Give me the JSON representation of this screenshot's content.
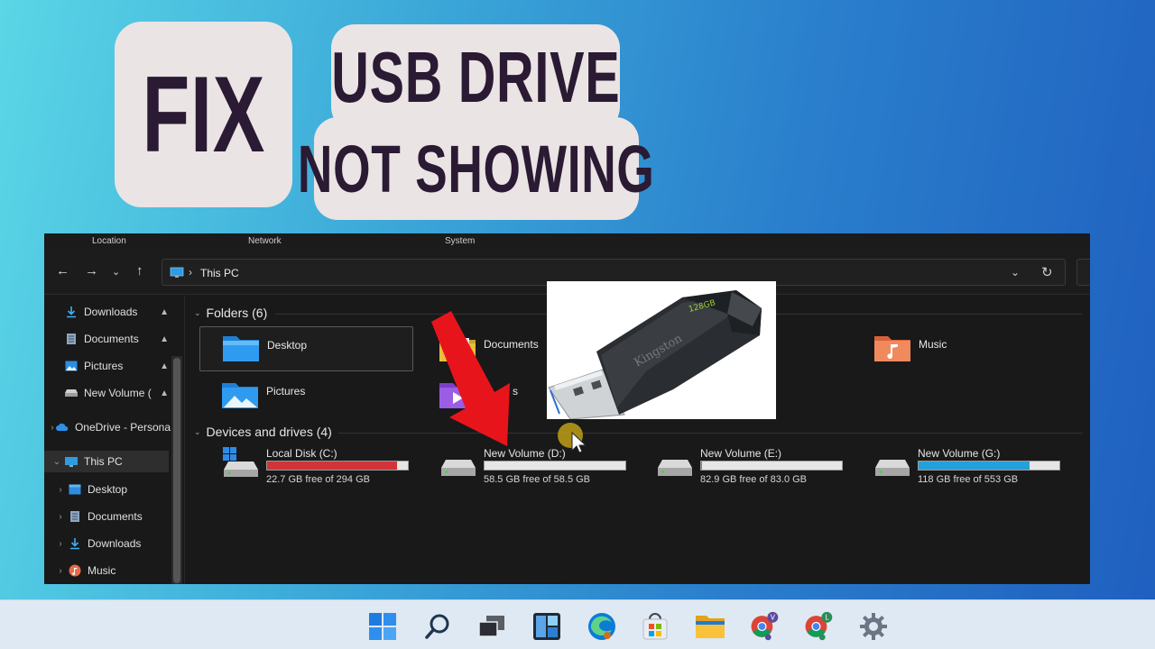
{
  "title_tiles": {
    "fix": "FIX",
    "usb_drive": "USB DRIVE",
    "not_showing": "NOT SHOWING"
  },
  "ribbon": {
    "groups": [
      "Location",
      "Network",
      "System"
    ]
  },
  "address_bar": {
    "path": "This PC",
    "icon": "this-pc-icon"
  },
  "navigation": {
    "back_icon": "back-arrow-icon",
    "forward_icon": "forward-arrow-icon",
    "recent_icon": "chevron-down-icon",
    "up_icon": "up-arrow-icon",
    "refresh_icon": "refresh-icon"
  },
  "sidebar": {
    "quick_access": [
      {
        "label": "Downloads",
        "icon": "download-icon",
        "pinned": true
      },
      {
        "label": "Documents",
        "icon": "documents-icon",
        "pinned": true
      },
      {
        "label": "Pictures",
        "icon": "pictures-icon",
        "pinned": true
      },
      {
        "label": "New Volume (",
        "icon": "drive-icon",
        "pinned": true
      }
    ],
    "onedrive": {
      "label": "OneDrive - Persona",
      "icon": "cloud-icon"
    },
    "this_pc": {
      "label": "This PC",
      "icon": "this-pc-icon"
    },
    "this_pc_children": [
      {
        "label": "Desktop",
        "icon": "desktop-icon"
      },
      {
        "label": "Documents",
        "icon": "documents-icon"
      },
      {
        "label": "Downloads",
        "icon": "download-icon"
      },
      {
        "label": "Music",
        "icon": "music-icon"
      }
    ]
  },
  "folders": {
    "header": "Folders (6)",
    "items": [
      {
        "label": "Desktop",
        "icon": "desktop-folder-icon"
      },
      {
        "label": "Documents",
        "icon": "documents-folder-icon"
      },
      {
        "label": "Music",
        "icon": "music-folder-icon"
      },
      {
        "label": "Pictures",
        "icon": "pictures-folder-icon"
      },
      {
        "label": "Videos",
        "icon": "videos-folder-icon"
      }
    ],
    "videos_visible_label": "s"
  },
  "drives": {
    "header": "Devices and drives (4)",
    "items": [
      {
        "name": "Local Disk (C:)",
        "free": "22.7 GB free of 294 GB",
        "used_fraction": 0.923,
        "bar_color": "#d13438",
        "icon": "windows-drive-icon"
      },
      {
        "name": "New Volume (D:)",
        "free": "58.5 GB free of 58.5 GB",
        "used_fraction": 0.0,
        "bar_color": "#26a0da",
        "icon": "drive-icon"
      },
      {
        "name": "New Volume (E:)",
        "free": "82.9 GB free of 83.0 GB",
        "used_fraction": 0.001,
        "bar_color": "#26a0da",
        "icon": "drive-icon"
      },
      {
        "name": "New Volume (G:)",
        "free": "118 GB free of 553 GB",
        "used_fraction": 0.787,
        "bar_color": "#26a0da",
        "icon": "drive-icon"
      }
    ]
  },
  "usb_photo": {
    "brand": "Kingston",
    "capacity": "128GB"
  },
  "taskbar": {
    "icons": [
      "start-icon",
      "search-icon",
      "task-view-icon",
      "widgets-icon",
      "edge-icon",
      "store-icon",
      "file-explorer-icon",
      "chrome-profile-v-icon",
      "chrome-profile-l-icon",
      "settings-icon"
    ],
    "profile_v": "V",
    "profile_l": "L"
  },
  "colors": {
    "background_start": "#5ad6e6",
    "background_end": "#1f5fbf",
    "tile_bg": "#ebe4e4",
    "tile_text": "#2a1a33",
    "explorer_bg": "#191919",
    "arrow": "#e8141c"
  }
}
